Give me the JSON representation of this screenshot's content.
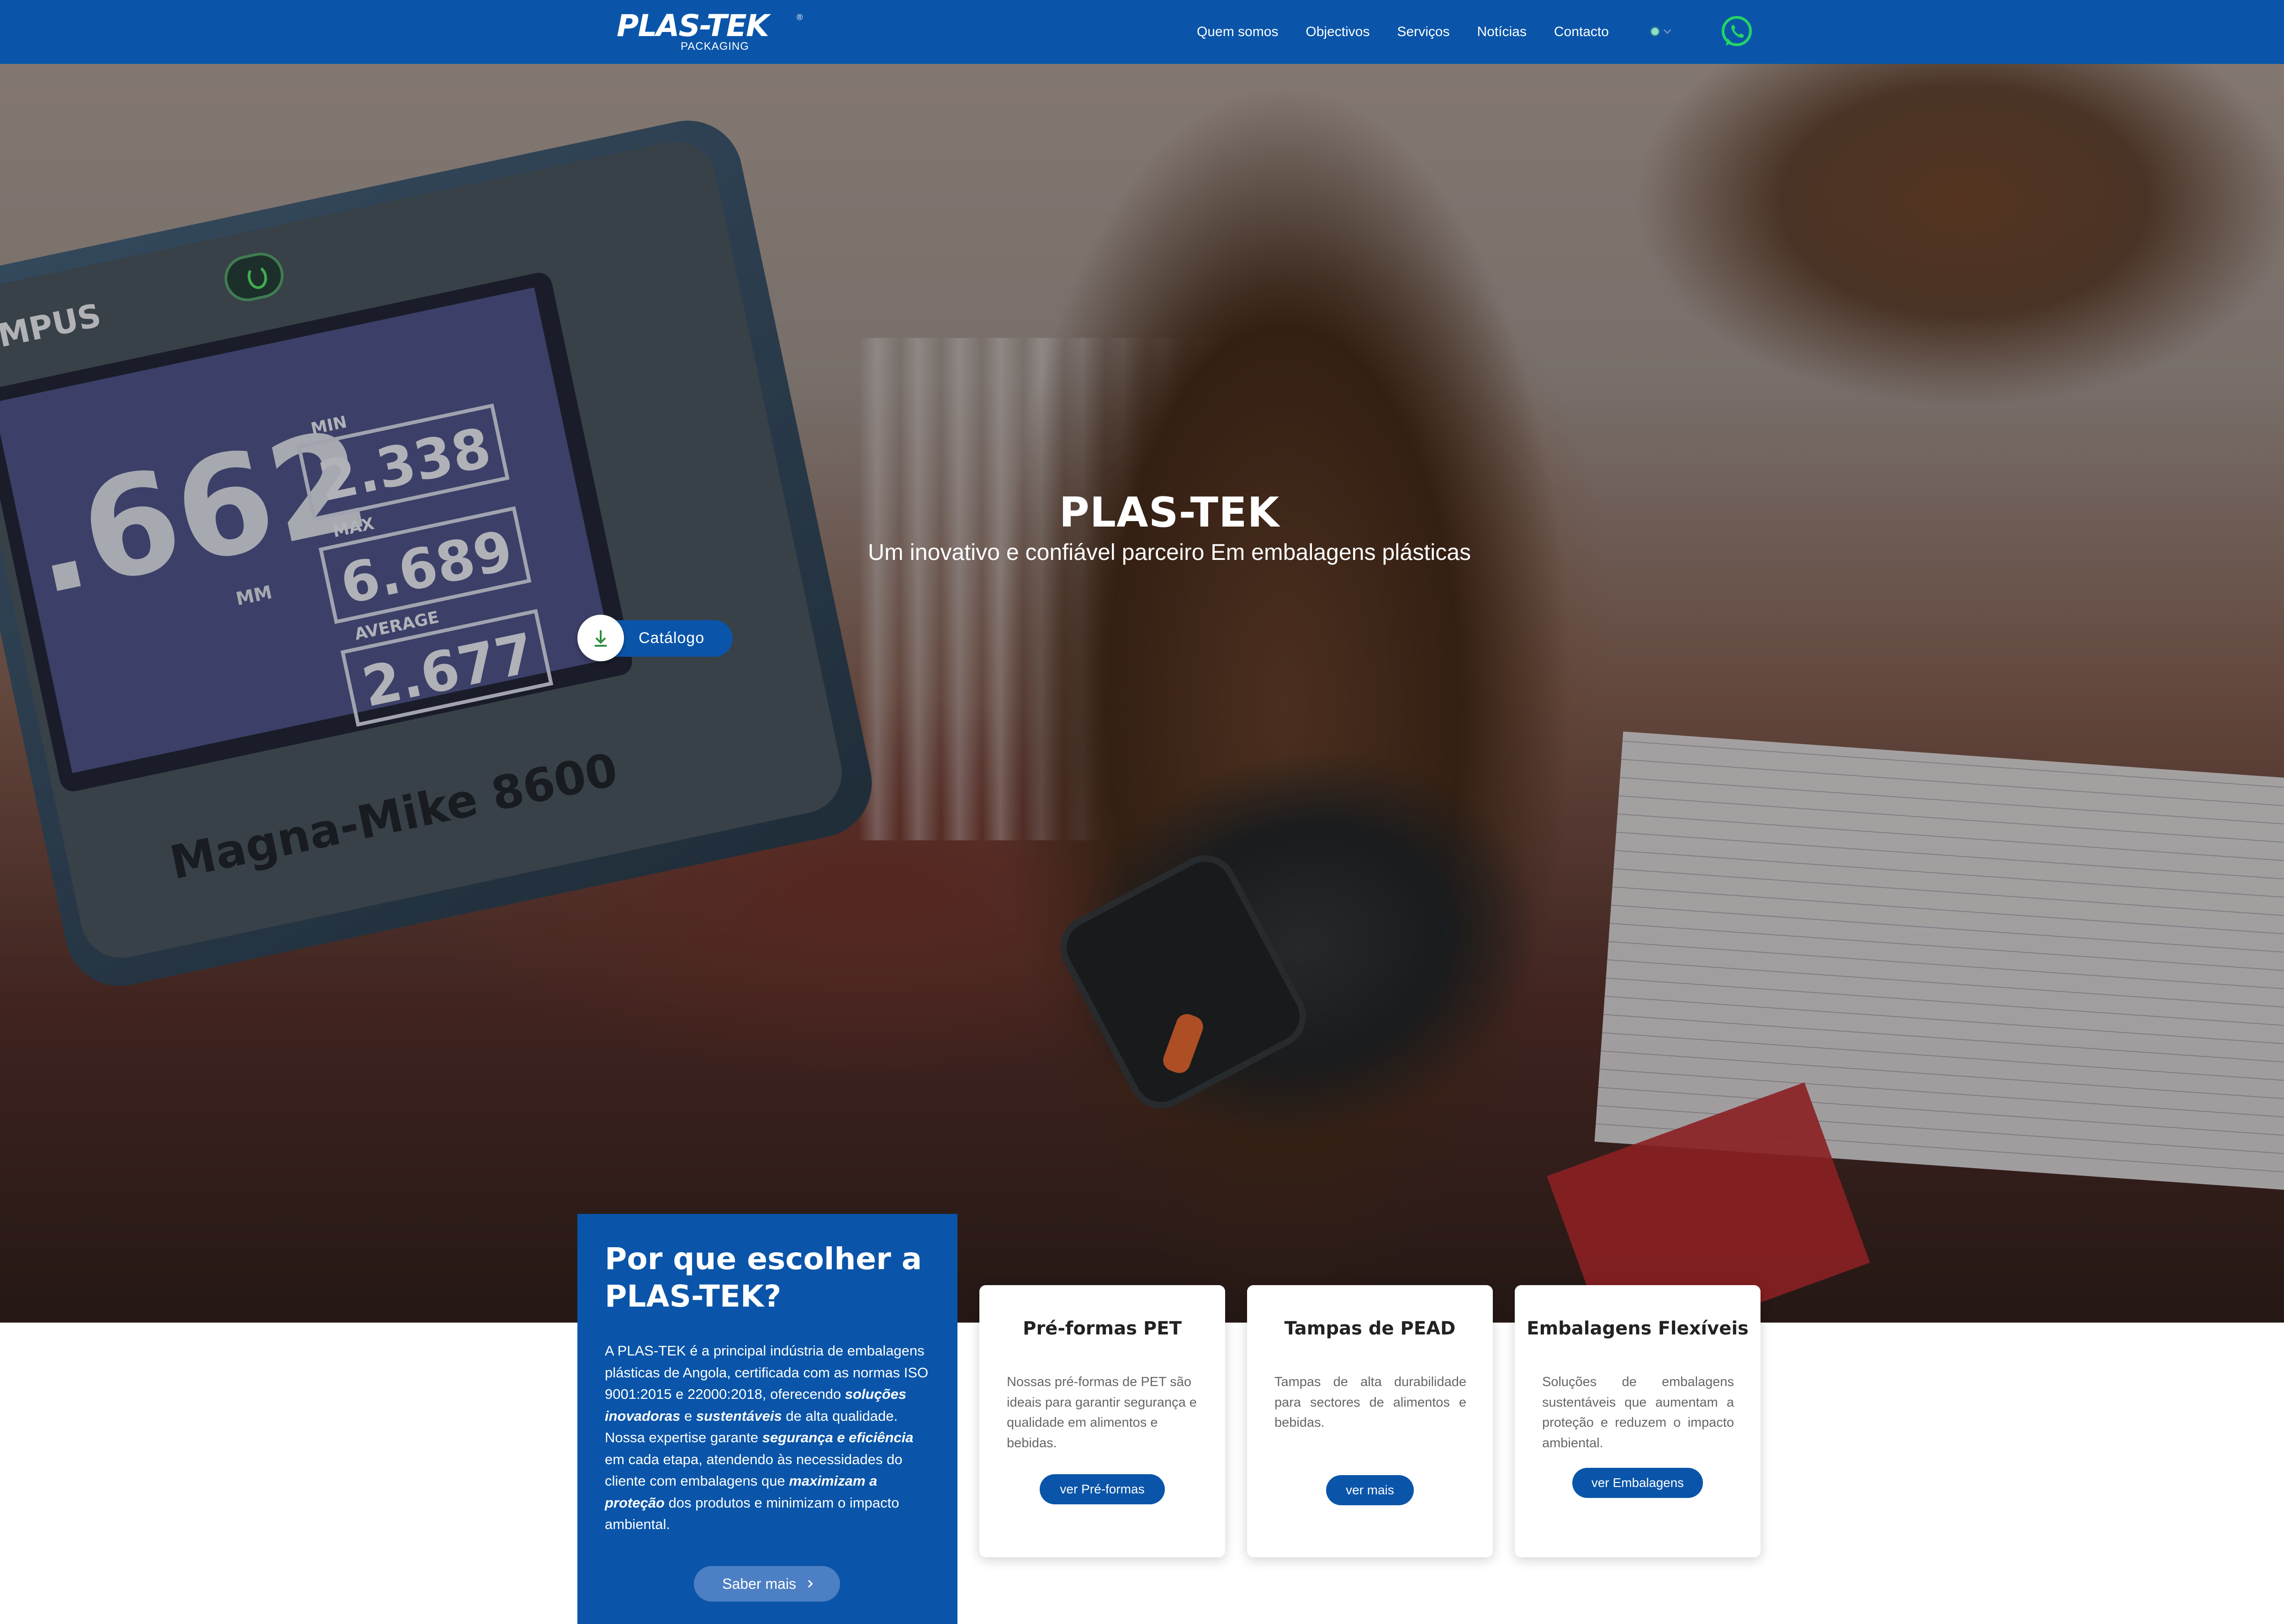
{
  "brand": {
    "logo_text": "PLAS-TEK",
    "logo_subtext": "PACKAGING",
    "logo_mark": "®"
  },
  "nav": {
    "items": [
      {
        "label": "Quem somos"
      },
      {
        "label": "Objectivos"
      },
      {
        "label": "Serviços"
      },
      {
        "label": "Notícias"
      },
      {
        "label": "Contacto"
      }
    ],
    "language_icon": "globe-icon",
    "whatsapp_icon": "whatsapp-icon"
  },
  "hero": {
    "title": "PLAS-TEK",
    "subtitle": "Um inovativo e confiável parceiro Em embalagens plásticas",
    "catalog_button": "Catálogo",
    "photo": {
      "device_brand": "YMPUS",
      "device_model": "Magna-Mike 8600",
      "reading_main": ".662",
      "reading_unit": "MM",
      "min_label": "MIN",
      "min_value": "2.338",
      "max_label": "MAX",
      "max_value": "6.689",
      "avg_label": "AVERAGE",
      "avg_value": "2.677"
    }
  },
  "why": {
    "title": "Por que escolher a PLAS-TEK?",
    "paragraph": [
      {
        "text": "A PLAS-TEK é a principal indústria de embalagens plásticas de Angola, certificada com as normas ISO 9001:2015 e 22000:2018, oferecendo ",
        "em": false
      },
      {
        "text": "soluções inovadoras",
        "em": true
      },
      {
        "text": " e ",
        "em": false
      },
      {
        "text": "sustentáveis",
        "em": true
      },
      {
        "text": " de alta qualidade. Nossa expertise garante ",
        "em": false
      },
      {
        "text": "segurança e eficiência",
        "em": true
      },
      {
        "text": " em cada etapa, atendendo às necessidades do cliente com embalagens que ",
        "em": false
      },
      {
        "text": "maximizam a proteção",
        "em": true
      },
      {
        "text": " dos produtos e minimizam o impacto ambiental.",
        "em": false
      }
    ],
    "button": "Saber mais"
  },
  "cards": [
    {
      "title": "Pré-formas PET",
      "text": "Nossas pré-formas de PET são ideais para garantir segurança e qualidade em alimentos e bebidas.",
      "button": "ver Pré-formas"
    },
    {
      "title": "Tampas de PEAD",
      "text": "Tampas de alta durabilidade para sectores de alimentos e bebidas.",
      "button": "ver mais"
    },
    {
      "title": "Embalagens Flexíveis",
      "text": "Soluções de embalagens sustentáveis que aumentam a proteção e reduzem o impacto ambiental.",
      "button": "ver Embalagens"
    }
  ],
  "colors": {
    "brand_blue": "#0a55a9",
    "button_light_blue": "#4d7fc4",
    "whatsapp_green": "#25d366",
    "download_green": "#2e8b3a"
  },
  "back_to_top_icon": "arrow-up-icon"
}
